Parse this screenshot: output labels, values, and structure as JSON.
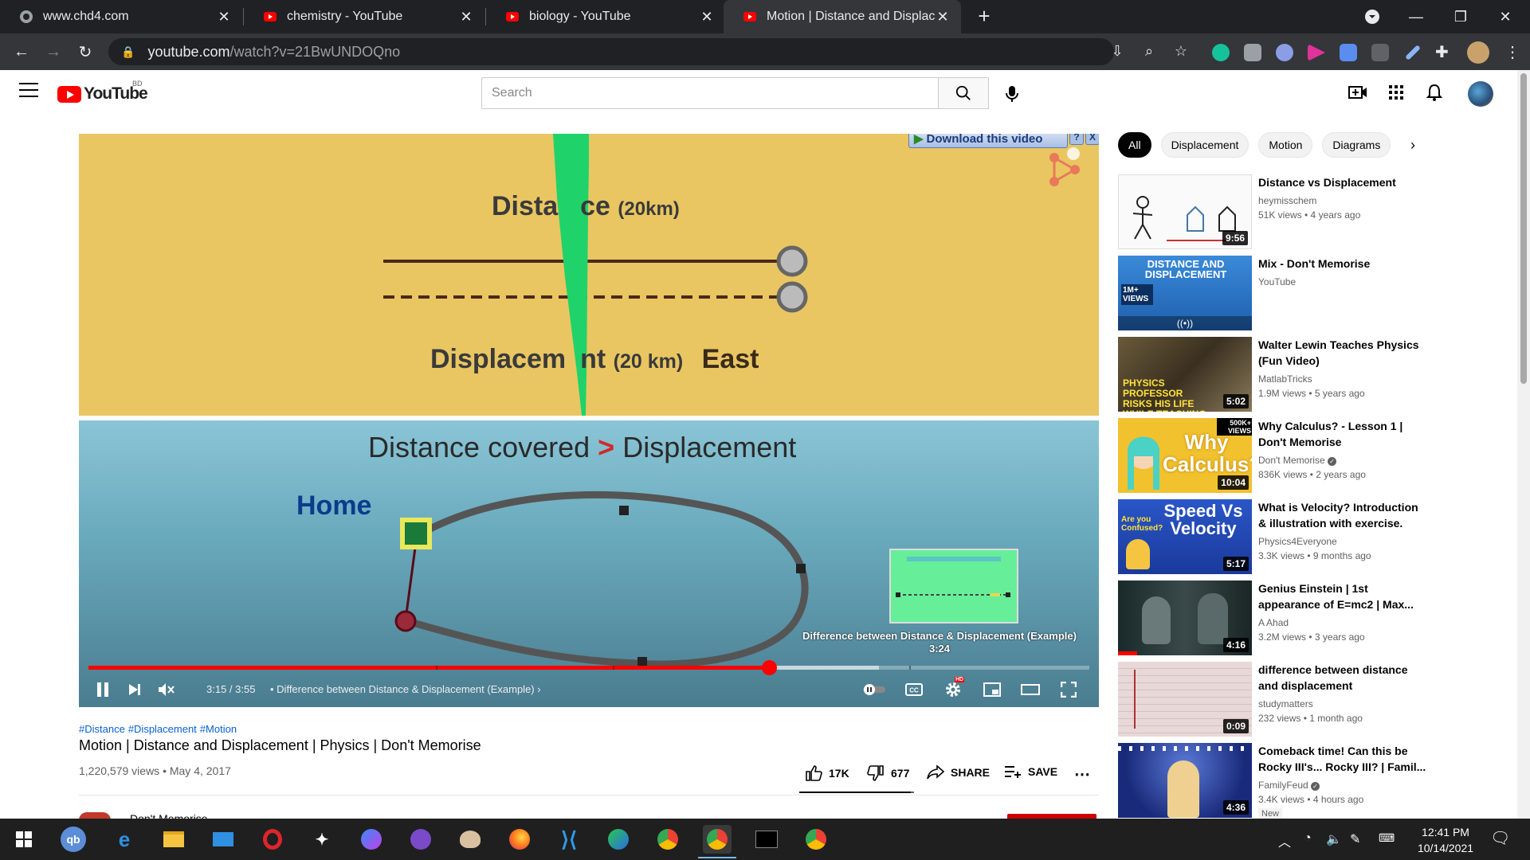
{
  "browser": {
    "tabs": [
      {
        "title": "www.chd4.com",
        "icon": "globe-icon",
        "active": false
      },
      {
        "title": "chemistry - YouTube",
        "icon": "youtube-icon",
        "active": false
      },
      {
        "title": "biology - YouTube",
        "icon": "youtube-icon",
        "active": false
      },
      {
        "title": "Motion | Distance and Displacem",
        "icon": "youtube-icon",
        "active": true
      }
    ],
    "url_host": "youtube.com",
    "url_path": "/watch?v=21BwUNDOQno"
  },
  "youtube": {
    "logo_text": "YouTube",
    "country_code": "BD",
    "search_placeholder": "Search"
  },
  "player": {
    "download_banner": "Download this video",
    "download_help": "?",
    "download_close": "X",
    "scene": {
      "distance_label": "Dista",
      "distance_label_tail": "ce",
      "distance_value": "(20km)",
      "displacement_label": "Displacem",
      "displacement_label_tail": "nt",
      "displacement_value": "(20 km)",
      "direction": "East",
      "compare_left": "Distance covered",
      "compare_symbol": ">",
      "compare_right": "Displacement",
      "home_label": "Home"
    },
    "endscreen_caption": "Difference between Distance & Displacement (Example)",
    "endscreen_duration": "3:24",
    "time_current": "3:15",
    "time_total": "3:55",
    "time_display": "3:15 / 3:55",
    "chapter": "• Difference between Distance & Displacement (Example)",
    "played_fraction": 0.68,
    "buffered_fraction": 0.79,
    "hd_badge": "HD",
    "accent_color": "#ff0000"
  },
  "video": {
    "hashtags": [
      "#Distance",
      "#Displacement",
      "#Motion"
    ],
    "title": "Motion | Distance and Displacement | Physics | Don't Memorise",
    "views": "1,220,579 views",
    "date": "May 4, 2017",
    "meta": "1,220,579 views • May 4, 2017",
    "likes": "17K",
    "dislikes": "677",
    "share_label": "SHARE",
    "save_label": "SAVE",
    "channel_name": "Don't Memorise"
  },
  "sidebar": {
    "chips": [
      "All",
      "Displacement",
      "Motion",
      "Diagrams"
    ],
    "recommendations": [
      {
        "title": "Distance vs Displacement",
        "channel": "heymisschem",
        "meta": "51K views • 4 years ago",
        "duration": "9:56"
      },
      {
        "title": "Mix - Don't Memorise",
        "channel": "YouTube",
        "meta": "",
        "duration": "",
        "thumb_text": "DISTANCE AND DISPLACEMENT",
        "thumb_badge": "1M+ VIEWS"
      },
      {
        "title": "Walter Lewin Teaches Physics (Fun Video)",
        "channel": "MatlabTricks",
        "meta": "1.9M views • 5 years ago",
        "duration": "5:02",
        "thumb_text": "PHYSICS PROFESSOR RISKS HIS LIFE WHILE TEACHING"
      },
      {
        "title": "Why Calculus? - Lesson 1 | Don't Memorise",
        "channel": "Don't Memorise",
        "meta": "836K views • 2 years ago",
        "duration": "10:04",
        "thumb_text": "Why Calculus?",
        "thumb_badge": "500K+ VIEWS",
        "verified": true
      },
      {
        "title": "What is Velocity? Introduction & illustration with exercise.",
        "channel": "Physics4Everyone",
        "meta": "3.3K views • 9 months ago",
        "duration": "5:17",
        "thumb_text": "Speed Vs Velocity",
        "thumb_badge": "Are you Confused?"
      },
      {
        "title": "Genius Einstein | 1st appearance of E=mc2 | Max...",
        "channel": "A Ahad",
        "meta": "3.2M views • 3 years ago",
        "duration": "4:16"
      },
      {
        "title": "difference between distance and displacement",
        "channel": "studymatters",
        "meta": "232 views • 1 month ago",
        "duration": "0:09"
      },
      {
        "title": "Comeback time! Can this be Rocky III's... Rocky III? | Famil...",
        "channel": "FamilyFeud",
        "meta": "3.4K views • 4 hours ago",
        "duration": "4:36",
        "badge": "New",
        "verified": true
      }
    ]
  },
  "taskbar": {
    "time": "12:41 PM",
    "date": "10/14/2021"
  }
}
